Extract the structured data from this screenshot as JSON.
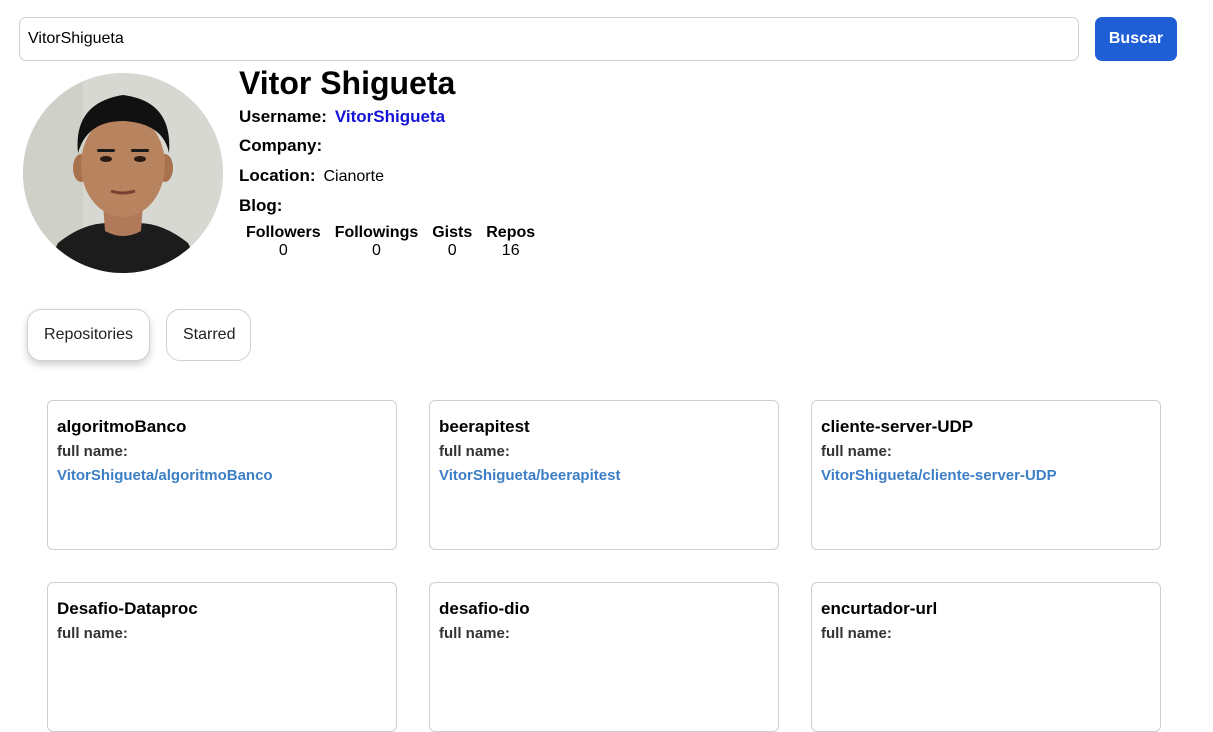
{
  "search": {
    "value": "VitorShigueta",
    "button_label": "Buscar"
  },
  "profile": {
    "name": "Vitor Shigueta",
    "username_label": "Username:",
    "username": "VitorShigueta",
    "company_label": "Company:",
    "company": "",
    "location_label": "Location:",
    "location": "Cianorte",
    "blog_label": "Blog:",
    "blog": ""
  },
  "stats": [
    {
      "label": "Followers",
      "value": "0"
    },
    {
      "label": "Followings",
      "value": "0"
    },
    {
      "label": "Gists",
      "value": "0"
    },
    {
      "label": "Repos",
      "value": "16"
    }
  ],
  "tabs": [
    {
      "label": "Repositories",
      "active": true
    },
    {
      "label": "Starred",
      "active": false
    }
  ],
  "repos": [
    {
      "name": "algoritmoBanco",
      "full_name_label": "full name:",
      "full_name": "VitorShigueta/algoritmoBanco"
    },
    {
      "name": "beerapitest",
      "full_name_label": "full name:",
      "full_name": "VitorShigueta/beerapitest"
    },
    {
      "name": "cliente-server-UDP",
      "full_name_label": "full name:",
      "full_name": "VitorShigueta/cliente-server-UDP"
    },
    {
      "name": "Desafio-Dataproc",
      "full_name_label": "full name:",
      "full_name": ""
    },
    {
      "name": "desafio-dio",
      "full_name_label": "full name:",
      "full_name": ""
    },
    {
      "name": "encurtador-url",
      "full_name_label": "full name:",
      "full_name": ""
    }
  ],
  "colors": {
    "accent": "#1f5fd6",
    "username_link": "#1414d6",
    "repo_link": "#3d7fc6"
  }
}
